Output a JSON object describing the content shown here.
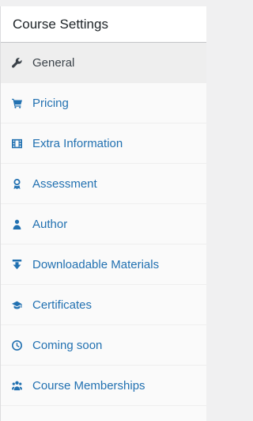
{
  "panel": {
    "title": "Course Settings"
  },
  "tabs": [
    {
      "label": "General",
      "icon": "wrench-icon",
      "active": true
    },
    {
      "label": "Pricing",
      "icon": "cart-icon",
      "active": false
    },
    {
      "label": "Extra Information",
      "icon": "film-icon",
      "active": false
    },
    {
      "label": "Assessment",
      "icon": "award-icon",
      "active": false
    },
    {
      "label": "Author",
      "icon": "user-icon",
      "active": false
    },
    {
      "label": "Downloadable Materials",
      "icon": "download-icon",
      "active": false
    },
    {
      "label": "Certificates",
      "icon": "graduation-cap-icon",
      "active": false
    },
    {
      "label": "Coming soon",
      "icon": "clock-icon",
      "active": false
    },
    {
      "label": "Course Memberships",
      "icon": "users-icon",
      "active": false
    }
  ],
  "colors": {
    "link": "#2271b1",
    "active_text": "#3c434a",
    "active_bg": "#eeeeee",
    "tab_bg": "#fafafa"
  }
}
